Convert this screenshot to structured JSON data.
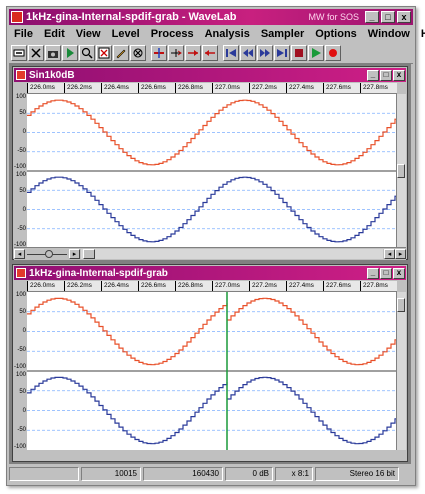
{
  "window": {
    "title": "1kHz-gina-Internal-spdif-grab - WaveLab",
    "extra": "MW for SOS",
    "min": "_",
    "max": "□",
    "close": "x"
  },
  "menu": [
    "File",
    "Edit",
    "View",
    "Level",
    "Process",
    "Analysis",
    "Sampler",
    "Options",
    "Window",
    "Help"
  ],
  "colors": {
    "title_bar": "#b01a7c",
    "wave_top": "#e8502a",
    "wave_bottom": "#2a3a9a",
    "cursor": "#1a9a3a",
    "grid": "#7fb0ff"
  },
  "windows": [
    {
      "title": "Sin1k0dB",
      "ruler": [
        "226.0ms",
        "226.2ms",
        "226.4ms",
        "226.6ms",
        "226.8ms",
        "227.0ms",
        "227.2ms",
        "227.4ms",
        "227.6ms",
        "227.8ms"
      ],
      "channels": [
        {
          "labels": [
            "100",
            "50",
            "0",
            "-50",
            "-100"
          ]
        },
        {
          "labels": [
            "100",
            "50",
            "0",
            "-50",
            "-100"
          ]
        }
      ]
    },
    {
      "title": "1kHz-gina-Internal-spdif-grab",
      "ruler": [
        "226.0ms",
        "226.2ms",
        "226.4ms",
        "226.6ms",
        "226.8ms",
        "227.0ms",
        "227.2ms",
        "227.4ms",
        "227.6ms",
        "227.8ms"
      ],
      "channels": [
        {
          "labels": [
            "100",
            "50",
            "0",
            "-50",
            "-100"
          ]
        },
        {
          "labels": [
            "100",
            "50",
            "0",
            "-50",
            "-100"
          ]
        }
      ]
    }
  ],
  "status": {
    "blank": "",
    "position": "10015",
    "samples": "160430",
    "level": "0 dB",
    "zoom": "x 8:1",
    "format": "Stereo 16 bit"
  }
}
